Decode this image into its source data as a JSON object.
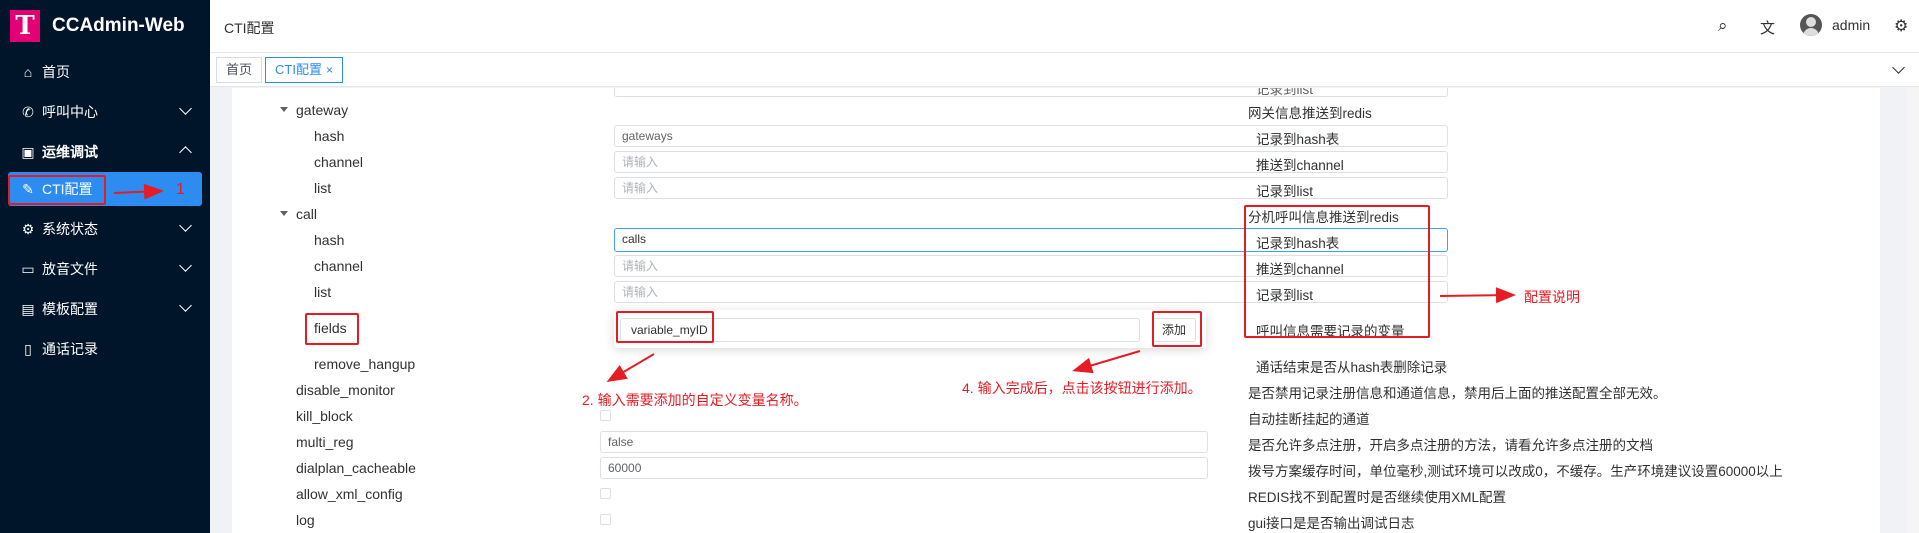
{
  "app": {
    "logo_letter": "T",
    "title": "CCAdmin-Web"
  },
  "sidebar": {
    "items": [
      {
        "label": "首页",
        "icon": "home-icon",
        "glyph": "⌂"
      },
      {
        "label": "呼叫中心",
        "icon": "phone-icon",
        "glyph": "✆"
      },
      {
        "label": "运维调试",
        "icon": "debug-icon",
        "glyph": "▣"
      },
      {
        "label": "CTI配置",
        "icon": "edit-icon",
        "glyph": "✎"
      },
      {
        "label": "系统状态",
        "icon": "chip-icon",
        "glyph": "⚙"
      },
      {
        "label": "放音文件",
        "icon": "folder-icon",
        "glyph": "▭"
      },
      {
        "label": "模板配置",
        "icon": "template-icon",
        "glyph": "▤"
      },
      {
        "label": "通话记录",
        "icon": "record-icon",
        "glyph": "▯"
      }
    ]
  },
  "header": {
    "breadcrumb": "CTI配置",
    "user": "admin",
    "search_icon": "⌕",
    "translate_icon": "文",
    "settings_icon": "⚙"
  },
  "tabs": [
    {
      "label": "首页"
    },
    {
      "label": "CTI配置",
      "close": "×"
    }
  ],
  "form": {
    "top_desc": "记录到list",
    "gateway": {
      "label": "gateway",
      "desc": "网关信息推送到redis",
      "hash": {
        "label": "hash",
        "value": "gateways",
        "desc": "记录到hash表"
      },
      "channel": {
        "label": "channel",
        "placeholder": "请输入",
        "desc": "推送到channel"
      },
      "list": {
        "label": "list",
        "placeholder": "请输入",
        "desc": "记录到list"
      }
    },
    "call": {
      "label": "call",
      "desc": "分机呼叫信息推送到redis",
      "hash": {
        "label": "hash",
        "value": "calls",
        "desc": "记录到hash表"
      },
      "channel": {
        "label": "channel",
        "placeholder": "请输入",
        "desc": "推送到channel"
      },
      "list": {
        "label": "list",
        "placeholder": "请输入",
        "desc": "记录到list"
      },
      "fields": {
        "label": "fields",
        "value": "variable_myID",
        "button": "添加",
        "desc": "呼叫信息需要记录的变量"
      },
      "remove_hangup": {
        "label": "remove_hangup",
        "desc": "通话结束是否从hash表删除记录"
      }
    },
    "disable_monitor": {
      "label": "disable_monitor",
      "desc": "是否禁用记录注册信息和通道信息，禁用后上面的推送配置全部无效。"
    },
    "kill_block": {
      "label": "kill_block",
      "desc": "自动挂断挂起的通道"
    },
    "multi_reg": {
      "label": "multi_reg",
      "value": "false",
      "desc": "是否允许多点注册，开启多点注册的方法，请看允许多点注册的文档"
    },
    "dialplan_cacheable": {
      "label": "dialplan_cacheable",
      "value": "60000",
      "desc": "拨号方案缓存时间，单位毫秒,测试环境可以改成0，不缓存。生产环境建议设置60000以上"
    },
    "allow_xml_config": {
      "label": "allow_xml_config",
      "desc": "REDIS找不到配置时是否继续使用XML配置"
    },
    "log": {
      "label": "log",
      "desc": "gui接口是是否输出调试日志"
    }
  },
  "annotations": {
    "step1": "1",
    "step2": "2. 输入需要添加的自定义变量名称。",
    "step3": "配置说明",
    "step4": "4. 输入完成后，点击该按钮进行添加。"
  },
  "colors": {
    "sidebar_bg": "#001529",
    "active": "#2d8cf0",
    "annotation": "#e51c23",
    "logo": "#e20074"
  }
}
